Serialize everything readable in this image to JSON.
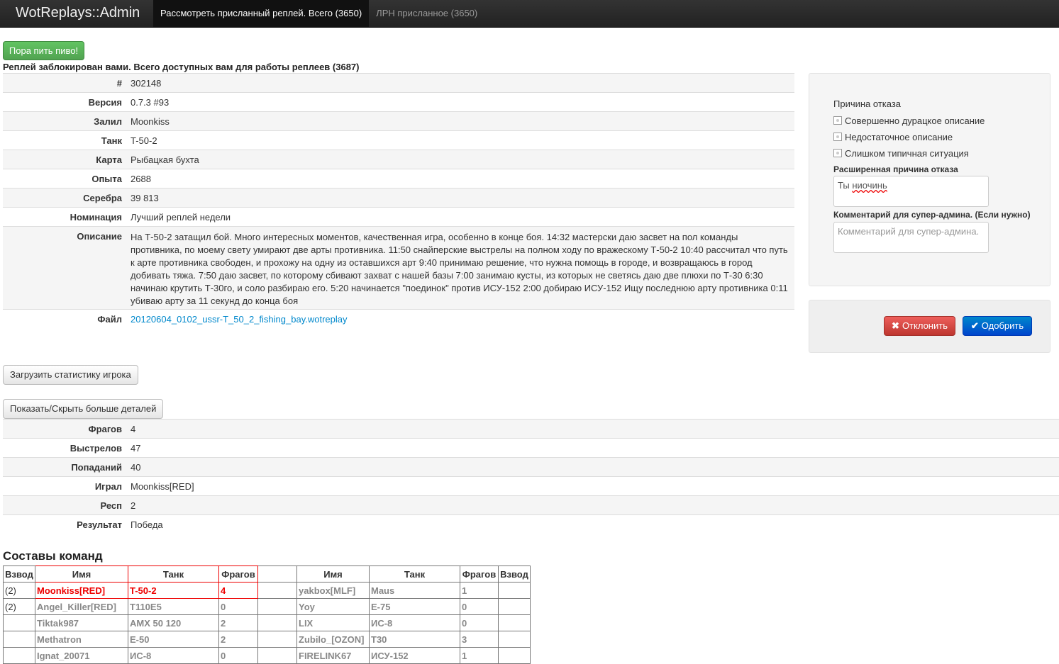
{
  "navbar": {
    "brand": "WotReplays::Admin",
    "links": [
      {
        "label": "Рассмотреть присланный реплей. Всего (3650)",
        "active": true
      },
      {
        "label": "ЛРН присланное (3650)",
        "active": false
      }
    ]
  },
  "beer_button": "Пора пить пиво!",
  "heading": "Реплей заблокирован вами. Всего доступных вам для работы реплеев (3687)",
  "details": [
    {
      "label": "#",
      "value": "302148"
    },
    {
      "label": "Версия",
      "value": "0.7.3 #93"
    },
    {
      "label": "Залил",
      "value": "Moonkiss"
    },
    {
      "label": "Танк",
      "value": "T-50-2"
    },
    {
      "label": "Карта",
      "value": "Рыбацкая бухта"
    },
    {
      "label": "Опыта",
      "value": "2688"
    },
    {
      "label": "Серебра",
      "value": "39 813"
    },
    {
      "label": "Номинация",
      "value": "Лучший реплей недели"
    },
    {
      "label": "Описание",
      "value": "На Т-50-2 затащил бой. Много интересных моментов, качественная игра, особенно в конце боя. 14:32 мастерски даю засвет на пол команды противника, по моему свету умирают две арты противника. 11:50 снайперские выстрелы на полном ходу по вражескому Т-50-2 10:40 рассчитал что путь к арте противника свободен, и прохожу на одну из оставшихся арт 9:40 принимаю решение, что нужна помощь в городе, и возвращаюсь в город добивать тяжа. 7:50 даю засвет, по которому сбивают захват с нашей базы 7:00 занимаю кусты, из которых не светясь даю две плюхи по Т-30 6:30 начинаю крутить Т-30го, и солo разбираю его. 5:20 начинается \"поединок\" против ИСУ-152 2:00 добираю ИСУ-152 Ищу последнюю арту противника 0:11 убиваю арту за 11 секунд до конца боя"
    },
    {
      "label": "Файл",
      "value": "20120604_0102_ussr-T_50_2_fishing_bay.wotreplay"
    }
  ],
  "reject_panel": {
    "title": "Причина отказа",
    "reasons": [
      "Совершенно дурацкое описание",
      "Недостаточное описание",
      "Слишком типичная ситуация"
    ],
    "extended_label": "Расширенная причина отказа",
    "extended_value_word1": "Ты",
    "extended_value_word2": "ниочинь",
    "comment_label": "Комментарий для супер-админа. (Если нужно)",
    "comment_placeholder": "Комментарий для супер-админа."
  },
  "actions": {
    "reject_icon": "✖",
    "reject": "Отклонить",
    "approve_icon": "✔",
    "approve": "Одобрить"
  },
  "load_stats_button": "Загрузить статистику игрока",
  "toggle_details_button": "Показать/Скрыть больше деталей",
  "stats": [
    {
      "label": "Фрагов",
      "value": "4"
    },
    {
      "label": "Выстрелов",
      "value": "47"
    },
    {
      "label": "Попаданий",
      "value": "40"
    },
    {
      "label": "Играл",
      "value": "Moonkiss[RED]"
    },
    {
      "label": "Респ",
      "value": "2"
    },
    {
      "label": "Результат",
      "value": "Победа"
    }
  ],
  "teams": {
    "title": "Составы команд",
    "headers": [
      "Взвод",
      "Имя",
      "Танк",
      "Фрагов",
      "",
      "Имя",
      "Танк",
      "Фрагов",
      "Взвод"
    ],
    "rows": [
      [
        "(2)",
        "Moonkiss[RED]",
        "T-50-2",
        "4",
        "",
        "yakbox[MLF]",
        "Maus",
        "1",
        ""
      ],
      [
        "(2)",
        "Angel_Killer[RED]",
        "T110E5",
        "0",
        "",
        "Yoy",
        "E-75",
        "0",
        ""
      ],
      [
        "",
        "Tiktak987",
        "AMX 50 120",
        "2",
        "",
        "LIX",
        "ИС-8",
        "0",
        ""
      ],
      [
        "",
        "Methatron",
        "E-50",
        "2",
        "",
        "Zubilo_[OZON]",
        "T30",
        "3",
        ""
      ],
      [
        "",
        "Ignat_20071",
        "ИС-8",
        "0",
        "",
        "FIRELINK67",
        "ИСУ-152",
        "1",
        ""
      ]
    ]
  },
  "colors": {
    "accent_red": "#e00000",
    "link": "#0088cc",
    "navbar": "#222222"
  }
}
